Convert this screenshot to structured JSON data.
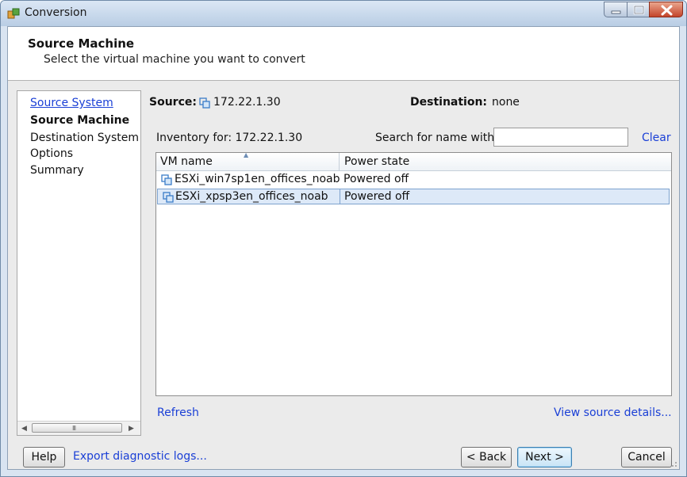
{
  "window": {
    "title": "Conversion"
  },
  "header": {
    "title": "Source Machine",
    "subtitle": "Select the virtual machine you want to convert"
  },
  "nav": {
    "items": [
      {
        "label": "Source System",
        "state": "link"
      },
      {
        "label": "Source Machine",
        "state": "current"
      },
      {
        "label": "Destination System",
        "state": "normal"
      },
      {
        "label": "Options",
        "state": "normal"
      },
      {
        "label": "Summary",
        "state": "normal"
      }
    ]
  },
  "source": {
    "label": "Source:",
    "host": "172.22.1.30",
    "destination_label": "Destination:",
    "destination_value": "none"
  },
  "inventory": {
    "label": "Inventory for: 172.22.1.30",
    "search_label": "Search for name with:",
    "search_value": "",
    "clear_label": "Clear"
  },
  "table": {
    "columns": [
      "VM name",
      "Power state"
    ],
    "sorted_column": "VM name",
    "rows": [
      {
        "name": "ESXi_win7sp1en_offices_noab",
        "power": "Powered off",
        "selected": false
      },
      {
        "name": "ESXi_xpsp3en_offices_noab",
        "power": "Powered off",
        "selected": true
      }
    ]
  },
  "links": {
    "refresh": "Refresh",
    "view_details": "View source details..."
  },
  "footer": {
    "help": "Help",
    "export_logs": "Export diagnostic logs...",
    "back": "< Back",
    "next": "Next >",
    "cancel": "Cancel"
  },
  "colors": {
    "link": "#1a3fd6",
    "selection": "#dde9f8",
    "selection_border": "#7da2ce",
    "titlebar": "#c6d7ec",
    "close_button": "#c4452b"
  }
}
